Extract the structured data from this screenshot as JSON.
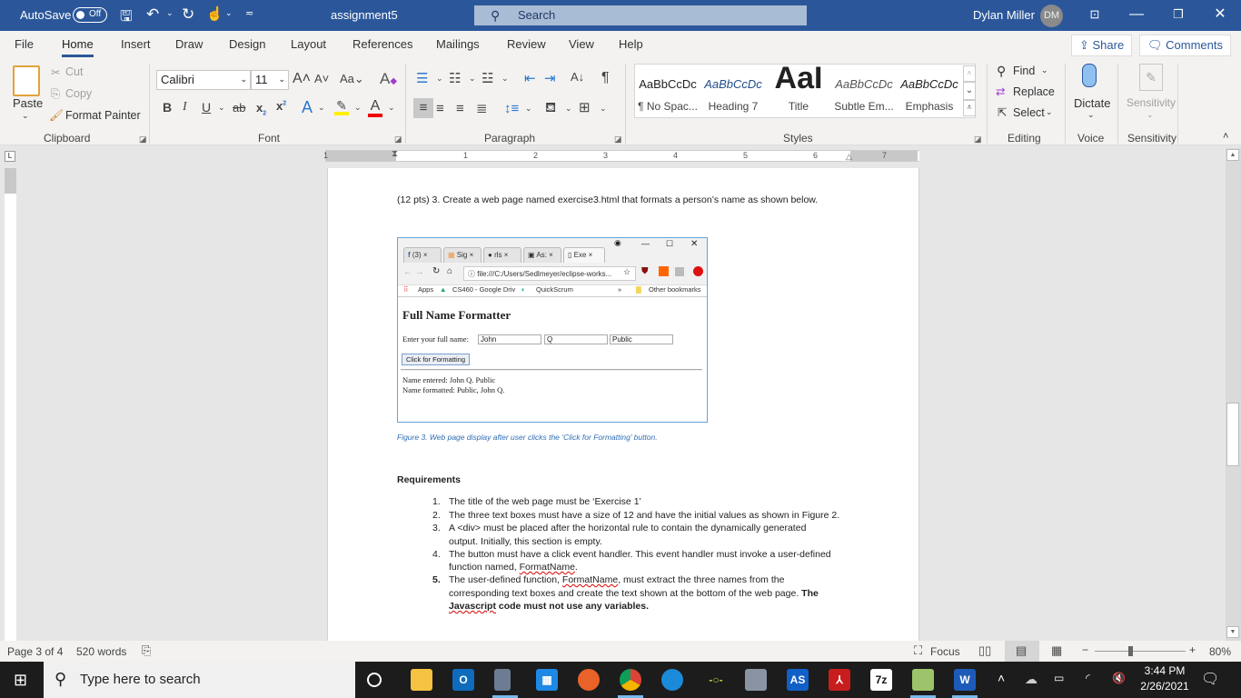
{
  "titlebar": {
    "autosave_label": "AutoSave",
    "autosave_state": "Off",
    "doc_title": "assignment5",
    "search_placeholder": "Search",
    "user_name": "Dylan Miller",
    "user_initials": "DM",
    "icons": [
      "save-icon",
      "undo-icon",
      "redo-icon",
      "touch-mode-icon",
      "customize-qat-icon",
      "ribbon-display-icon",
      "minimize-icon",
      "restore-icon",
      "close-icon"
    ]
  },
  "tabs": [
    "File",
    "Home",
    "Insert",
    "Draw",
    "Design",
    "Layout",
    "References",
    "Mailings",
    "Review",
    "View",
    "Help"
  ],
  "active_tab": "Home",
  "share_label": "Share",
  "comments_label": "Comments",
  "ribbon": {
    "clipboard": {
      "label": "Clipboard",
      "paste": "Paste",
      "cut": "Cut",
      "copy": "Copy",
      "format_painter": "Format Painter"
    },
    "font": {
      "label": "Font",
      "font_name": "Calibri",
      "font_size": "11",
      "change_case": "Aa"
    },
    "paragraph": {
      "label": "Paragraph"
    },
    "styles": {
      "label": "Styles",
      "items": [
        {
          "preview": "AaBbCcDc",
          "name": "¶ No Spac..."
        },
        {
          "preview": "AaBbCcDc",
          "name": "Heading 7"
        },
        {
          "preview": "AaI",
          "name": "Title"
        },
        {
          "preview": "AaBbCcDc",
          "name": "Subtle Em..."
        },
        {
          "preview": "AaBbCcDc",
          "name": "Emphasis"
        }
      ]
    },
    "editing": {
      "label": "Editing",
      "find": "Find",
      "replace": "Replace",
      "select": "Select"
    },
    "voice": {
      "label": "Voice",
      "dictate": "Dictate"
    },
    "sensitivity": {
      "label": "Sensitivity",
      "button": "Sensitivity"
    }
  },
  "ruler": {
    "marks": [
      "1",
      "1",
      "2",
      "3",
      "4",
      "5",
      "6",
      "7"
    ]
  },
  "document": {
    "intro": "(12 pts) 3. Create a web page named exercise3.html that formats a person’s name as shown below.",
    "figure": {
      "browser_tabs": [
        "(3)",
        "Sig",
        "rls",
        "As:",
        "Exe"
      ],
      "url": "file:///C:/Users/Sedlmeyer/eclipse-works...",
      "bookmarks": [
        "Apps",
        "CS460 - Google Driv",
        "QuickScrum",
        "Other bookmarks"
      ],
      "heading": "Full Name Formatter",
      "prompt": "Enter your full name:",
      "inputs": [
        "John",
        "Q",
        "Public"
      ],
      "button": "Click for Formatting",
      "output_line1": "Name entered: John Q. Public",
      "output_line2": "Name formatted: Public, John Q."
    },
    "caption": "Figure 3. Web page display after user clicks the ‘Click for Formatting’ button.",
    "requirements_heading": "Requirements",
    "requirements": [
      {
        "num": "1.",
        "lines": [
          "The title of the web page must be ‘Exercise 1’"
        ]
      },
      {
        "num": "2.",
        "lines": [
          "The three text boxes must have a size of 12 and have the initial values as shown in Figure 2."
        ]
      },
      {
        "num": "3.",
        "lines": [
          "A <div> must be placed after the horizontal rule to contain the dynamically generated",
          "output. Initially, this section is empty."
        ]
      },
      {
        "num": "4.",
        "line1": "The button must have a click event handler. This event handler must invoke a user-defined",
        "line2_pre": "function named, ",
        "line2_sq": "FormatName",
        "line2_post": "."
      },
      {
        "num": "5.",
        "line1_pre": "The user-defined function, ",
        "line1_sq": "FormatName",
        "line1_post": ", must extract the three names from the",
        "line2_pre": "corresponding text boxes and create the text shown at the bottom of the web page. ",
        "line2_bold": "The",
        "line3_sq": "Javascript",
        "line3_bold": " code must not use any variables."
      }
    ]
  },
  "statusbar": {
    "page": "Page 3 of 4",
    "words": "520 words",
    "focus": "Focus",
    "zoom": "80%",
    "zoom_level_percent": 80
  },
  "taskbar": {
    "search_placeholder": "Type here to search",
    "time": "3:44 PM",
    "date": "2/26/2021",
    "apps": [
      "cortana",
      "file-explorer",
      "outlook",
      "calculator",
      "calendar",
      "firefox",
      "chrome",
      "edge",
      "app-green",
      "app-network",
      "as-app",
      "acrobat",
      "7zip",
      "notepad-plus",
      "word"
    ]
  }
}
